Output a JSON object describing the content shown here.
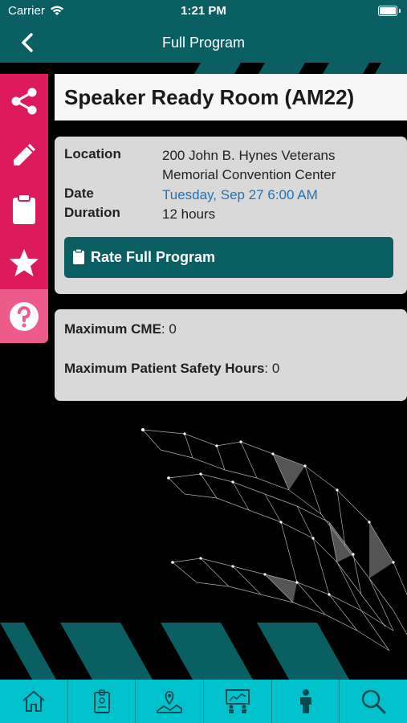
{
  "status": {
    "carrier": "Carrier",
    "time": "1:21 PM"
  },
  "nav": {
    "title": "Full Program"
  },
  "sidebar": [
    {
      "icon": "share-icon"
    },
    {
      "icon": "pencil-icon"
    },
    {
      "icon": "clipboard-icon"
    },
    {
      "icon": "star-icon"
    },
    {
      "icon": "help-icon"
    }
  ],
  "session": {
    "title": "Speaker Ready Room (AM22)",
    "location_label": "Location",
    "location_value_line1": "200 John B. Hynes Veterans",
    "location_value_line2": "Memorial Convention Center",
    "date_label": "Date",
    "date_value": "Tuesday, Sep 27 6:00 AM",
    "duration_label": "Duration",
    "duration_value": "12 hours",
    "rate_button": "Rate Full Program"
  },
  "credits": {
    "cme_label": "Maximum CME",
    "cme_value": ": 0",
    "safety_label": "Maximum Patient Safety Hours",
    "safety_value": ": 0"
  },
  "tabs": [
    {
      "icon": "home-icon"
    },
    {
      "icon": "badge-icon"
    },
    {
      "icon": "map-icon"
    },
    {
      "icon": "presentation-icon"
    },
    {
      "icon": "person-icon"
    },
    {
      "icon": "search-icon"
    }
  ],
  "colors": {
    "primary": "#0a5f63",
    "accent": "#dd1a5b",
    "tabbar": "#00c2cc",
    "link": "#1e73be"
  }
}
